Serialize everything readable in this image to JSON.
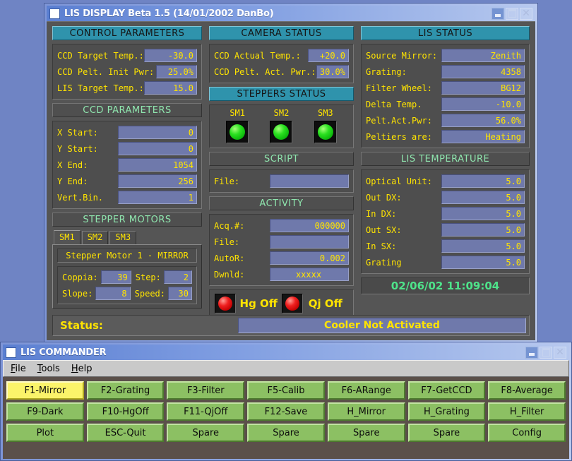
{
  "display_window": {
    "title": "LIS DISPLAY Beta 1.5 (14/01/2002 DanBo)",
    "icon": "window-icon",
    "buttons": {
      "minimize": "minimize-icon",
      "maximize": "maximize-icon",
      "close": "close-icon"
    },
    "control_parameters": {
      "header": "CONTROL PARAMETERS",
      "rows": [
        {
          "label": "CCD Target Temp.:",
          "value": "-30.0"
        },
        {
          "label": "CCD Pelt. Init Pwr:",
          "value": "25.0%"
        },
        {
          "label": "LIS Target Temp.:",
          "value": "15.0"
        }
      ]
    },
    "ccd_parameters": {
      "header": "CCD PARAMETERS",
      "rows": [
        {
          "label": "X Start:",
          "value": "0"
        },
        {
          "label": "Y Start:",
          "value": "0"
        },
        {
          "label": "X End:",
          "value": "1054"
        },
        {
          "label": "Y End:",
          "value": "256"
        },
        {
          "label": "Vert.Bin.",
          "value": "1"
        }
      ]
    },
    "stepper_motors": {
      "header": "STEPPER MOTORS",
      "tabs": [
        {
          "label": "SM1",
          "active": true
        },
        {
          "label": "SM2",
          "active": false
        },
        {
          "label": "SM3",
          "active": false
        }
      ],
      "motor_title": "Stepper Motor 1 - MIRROR",
      "fields": [
        {
          "label": "Coppia:",
          "value": "39"
        },
        {
          "label": "Step:",
          "value": "2"
        },
        {
          "label": "Slope:",
          "value": "8"
        },
        {
          "label": "Speed:",
          "value": "30"
        }
      ]
    },
    "camera_status": {
      "header": "CAMERA STATUS",
      "rows": [
        {
          "label": "CCD Actual Temp.:",
          "value": "+20.0"
        },
        {
          "label": "CCD Pelt. Act. Pwr.:",
          "value": "30.0%"
        }
      ]
    },
    "steppers_status": {
      "header": "STEPPERS STATUS",
      "leds": [
        {
          "label": "SM1",
          "color": "green"
        },
        {
          "label": "SM2",
          "color": "green"
        },
        {
          "label": "SM3",
          "color": "green"
        }
      ]
    },
    "script": {
      "header": "SCRIPT",
      "rows": [
        {
          "label": "File:",
          "value": ""
        }
      ]
    },
    "activity": {
      "header": "ACTIVITY",
      "rows": [
        {
          "label": "Acq.#:",
          "value": "000000"
        },
        {
          "label": "File:",
          "value": ""
        },
        {
          "label": "AutoR:",
          "value": "0.002"
        },
        {
          "label": "Dwnld:",
          "value": "xxxxx"
        }
      ]
    },
    "lamps": [
      {
        "label": "Hg Off",
        "color": "red",
        "icon": "hg-lamp-indicator"
      },
      {
        "label": "Qj Off",
        "color": "red",
        "icon": "qj-lamp-indicator"
      }
    ],
    "lis_status": {
      "header": "LIS STATUS",
      "rows": [
        {
          "label": "Source Mirror:",
          "value": "Zenith"
        },
        {
          "label": "Grating:",
          "value": "4358"
        },
        {
          "label": "Filter Wheel:",
          "value": "BG12"
        },
        {
          "label": "Delta Temp.",
          "value": "-10.0"
        },
        {
          "label": "Pelt.Act.Pwr:",
          "value": "56.0%"
        },
        {
          "label": "Peltiers are:",
          "value": "Heating"
        }
      ]
    },
    "lis_temperature": {
      "header": "LIS TEMPERATURE",
      "rows": [
        {
          "label": "Optical Unit:",
          "value": "5.0"
        },
        {
          "label": "Out DX:",
          "value": "5.0"
        },
        {
          "label": "In DX:",
          "value": "5.0"
        },
        {
          "label": "Out SX:",
          "value": "5.0"
        },
        {
          "label": "In SX:",
          "value": "5.0"
        },
        {
          "label": "Grating",
          "value": "5.0"
        }
      ]
    },
    "clock": "02/06/02 11:09:04",
    "status": {
      "label": "Status:",
      "value": "Cooler Not Activated"
    }
  },
  "commander_window": {
    "title": "LIS COMMANDER",
    "icon": "window-icon",
    "menu": [
      {
        "mnemonic": "F",
        "rest": "ile"
      },
      {
        "mnemonic": "T",
        "rest": "ools"
      },
      {
        "mnemonic": "H",
        "rest": "elp"
      }
    ],
    "buttons": [
      {
        "label": "F1-Mirror",
        "focused": true
      },
      {
        "label": "F2-Grating",
        "focused": false
      },
      {
        "label": "F3-Filter",
        "focused": false
      },
      {
        "label": "F5-Calib",
        "focused": false
      },
      {
        "label": "F6-ARange",
        "focused": false
      },
      {
        "label": "F7-GetCCD",
        "focused": false
      },
      {
        "label": "F8-Average",
        "focused": false
      },
      {
        "label": "F9-Dark",
        "focused": false
      },
      {
        "label": "F10-HgOff",
        "focused": false
      },
      {
        "label": "F11-QjOff",
        "focused": false
      },
      {
        "label": "F12-Save",
        "focused": false
      },
      {
        "label": "H_Mirror",
        "focused": false
      },
      {
        "label": "H_Grating",
        "focused": false
      },
      {
        "label": "H_Filter",
        "focused": false
      },
      {
        "label": "Plot",
        "focused": false
      },
      {
        "label": "ESC-Quit",
        "focused": false
      },
      {
        "label": "Spare",
        "focused": false
      },
      {
        "label": "Spare",
        "focused": false
      },
      {
        "label": "Spare",
        "focused": false
      },
      {
        "label": "Spare",
        "focused": false
      },
      {
        "label": "Config",
        "focused": false
      }
    ]
  },
  "colors": {
    "desktop": "#6f84c4",
    "panel": "#555555",
    "header_teal": "#2f93ac",
    "header_sub_text": "#8fe6ae",
    "field_bg": "#6f79ab",
    "label_yellow": "#ffe400",
    "clock_green": "#4ee38a",
    "button_green": "#8cc063",
    "button_focus_yellow": "#fbf36a",
    "commander_panel": "#5b504a"
  }
}
